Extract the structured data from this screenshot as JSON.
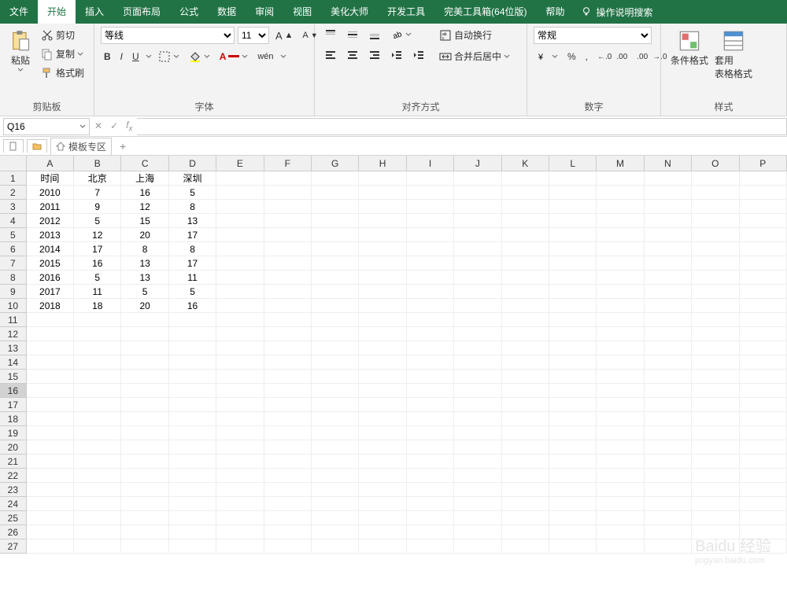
{
  "tabs": {
    "file": "文件",
    "home": "开始",
    "insert": "插入",
    "pagelayout": "页面布局",
    "formulas": "公式",
    "data": "数据",
    "review": "审阅",
    "view": "视图",
    "beautify": "美化大师",
    "dev": "开发工具",
    "perfect": "完美工具箱(64位版)",
    "help": "帮助",
    "search": "操作说明搜索"
  },
  "ribbon": {
    "clipboard": {
      "label": "剪贴板",
      "paste": "粘贴",
      "cut": "剪切",
      "copy": "复制",
      "format_painter": "格式刷"
    },
    "font": {
      "label": "字体",
      "name": "等线",
      "size": "11",
      "bold": "B",
      "italic": "I",
      "underline": "U",
      "pinyin": "wén"
    },
    "align": {
      "label": "对齐方式",
      "wrap": "自动换行",
      "merge": "合并后居中"
    },
    "number": {
      "label": "数字",
      "format": "常规",
      "percent": "%",
      "comma": ",",
      "inc": ".0",
      "dec": ".00"
    },
    "styles": {
      "label": "样式",
      "cond": "条件格式",
      "table": "套用\n表格格式"
    }
  },
  "namebox": "Q16",
  "sheettabs": {
    "templates": "模板专区"
  },
  "columns": [
    "A",
    "B",
    "C",
    "D",
    "E",
    "F",
    "G",
    "H",
    "I",
    "J",
    "K",
    "L",
    "M",
    "N",
    "O",
    "P"
  ],
  "data": {
    "headers": [
      "时间",
      "北京",
      "上海",
      "深圳"
    ],
    "rows": [
      [
        "2010",
        "7",
        "16",
        "5"
      ],
      [
        "2011",
        "9",
        "12",
        "8"
      ],
      [
        "2012",
        "5",
        "15",
        "13"
      ],
      [
        "2013",
        "12",
        "20",
        "17"
      ],
      [
        "2014",
        "17",
        "8",
        "8"
      ],
      [
        "2015",
        "16",
        "13",
        "17"
      ],
      [
        "2016",
        "5",
        "13",
        "11"
      ],
      [
        "2017",
        "11",
        "5",
        "5"
      ],
      [
        "2018",
        "18",
        "20",
        "16"
      ]
    ]
  },
  "selected": {
    "row": 16,
    "col": "Q"
  },
  "total_rows": 27,
  "watermark": {
    "main": "Baidu 经验",
    "sub": "jingyan.baidu.com"
  }
}
